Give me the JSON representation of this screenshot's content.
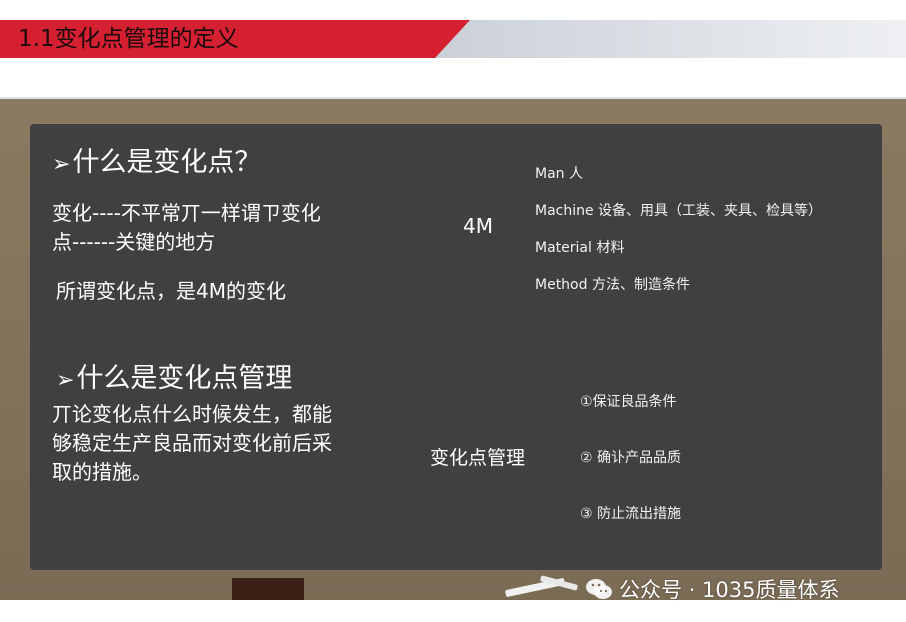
{
  "header": {
    "title": "1.1变化点管理的定义"
  },
  "section1": {
    "heading": "什么是变化点？",
    "line1": "变化----不平常丌一样谓ㄗ变化",
    "line2": "点------关键的地方",
    "line3": "所谓变化点，是4M的变化",
    "center_label": "4M",
    "items": [
      "Man 人",
      "Machine 设备、用具（工装、夹具、检具等）",
      "Material 材料",
      "Method 方法、制造条件"
    ]
  },
  "section2": {
    "heading": "什么是变化点管理",
    "line1": "丌论变化点什么时候发生，都能",
    "line2": "够稳定生产良品而对变化前后采",
    "line3": "取的措施。",
    "center_label": "变化点管理",
    "items": [
      "①保证良品条件",
      "② 确讣产品品质",
      "③ 防止流出措施"
    ]
  },
  "watermark": {
    "text": "公众号 · 1035质量体系"
  }
}
